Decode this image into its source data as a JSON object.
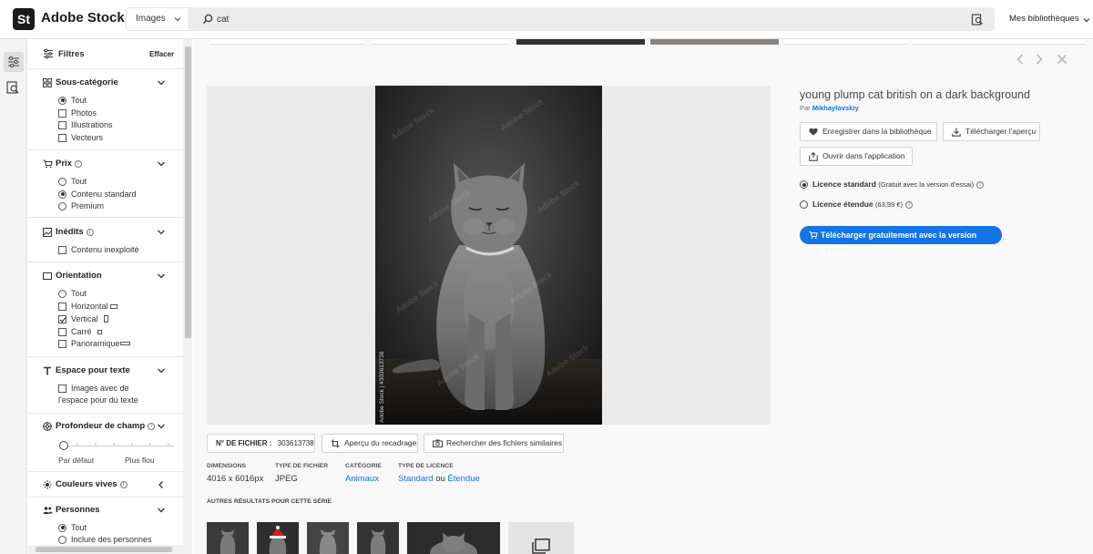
{
  "topbar": {
    "logo": "St",
    "app_title": "Adobe Stock",
    "asset_type": "Images",
    "search_value": "cat",
    "libraries": "Mes bibliothèques"
  },
  "filters": {
    "title": "Filtres",
    "clear": "Effacer",
    "subcategory": {
      "title": "Sous-catégorie",
      "options": [
        "Tout",
        "Photos",
        "Illustrations",
        "Vecteurs"
      ]
    },
    "price": {
      "title": "Prix",
      "options": [
        "Tout",
        "Contenu standard",
        "Premium"
      ]
    },
    "unreleased": {
      "title": "Inédits",
      "options": [
        "Contenu inexploité"
      ]
    },
    "orientation": {
      "title": "Orientation",
      "options": [
        "Tout",
        "Horizontal",
        "Vertical",
        "Carré",
        "Panoramique"
      ]
    },
    "copy_space": {
      "title": "Espace pour texte",
      "option_line1": "Images avec de",
      "option_line2": "l'espace pour du texte"
    },
    "depth": {
      "title": "Profondeur de champ",
      "left": "Par défaut",
      "right": "Plus flou"
    },
    "vivid": {
      "title": "Couleurs vives"
    },
    "people": {
      "title": "Personnes",
      "options": [
        "Tout",
        "Inclure des personnes"
      ]
    }
  },
  "detail": {
    "title": "young plump cat british on a dark background",
    "by": "Par",
    "author": "Mikhaylovskiy",
    "save_library": "Enregistrer dans la bibliothèque",
    "download_preview": "Télécharger l'aperçu",
    "open_in_app": "Ouvrir dans l'application",
    "license_standard": "Licence standard",
    "license_standard_note": "(Gratuit avec la version d'essai)",
    "license_extended": "Licence étendue",
    "license_extended_note": "(63,99 €)",
    "cta": "Télécharger gratuitement avec la version d'essai",
    "watermark": "Adobe Stock",
    "watermark_id": "Adobe Stock | #303613738"
  },
  "file": {
    "label": "N° DE FICHIER :",
    "number": "303613738",
    "crop_preview": "Aperçu du recadrage",
    "find_similar": "Rechercher des fichiers similaires"
  },
  "meta": {
    "dimensions_h": "DIMENSIONS",
    "dimensions_v": "4016 x 6016px",
    "filetype_h": "TYPE DE FICHIER",
    "filetype_v": "JPEG",
    "category_h": "CATÉGORIE",
    "category_v": "Animaux",
    "license_h": "TYPE DE LICENCE",
    "license_std": "Standard",
    "license_or": "ou",
    "license_ext": "Étendue",
    "series_title": "AUTRES RÉSULTATS POUR CETTE SÉRIE"
  },
  "colors": {
    "accent": "#1473e6",
    "dark": "#1b1b1b"
  }
}
